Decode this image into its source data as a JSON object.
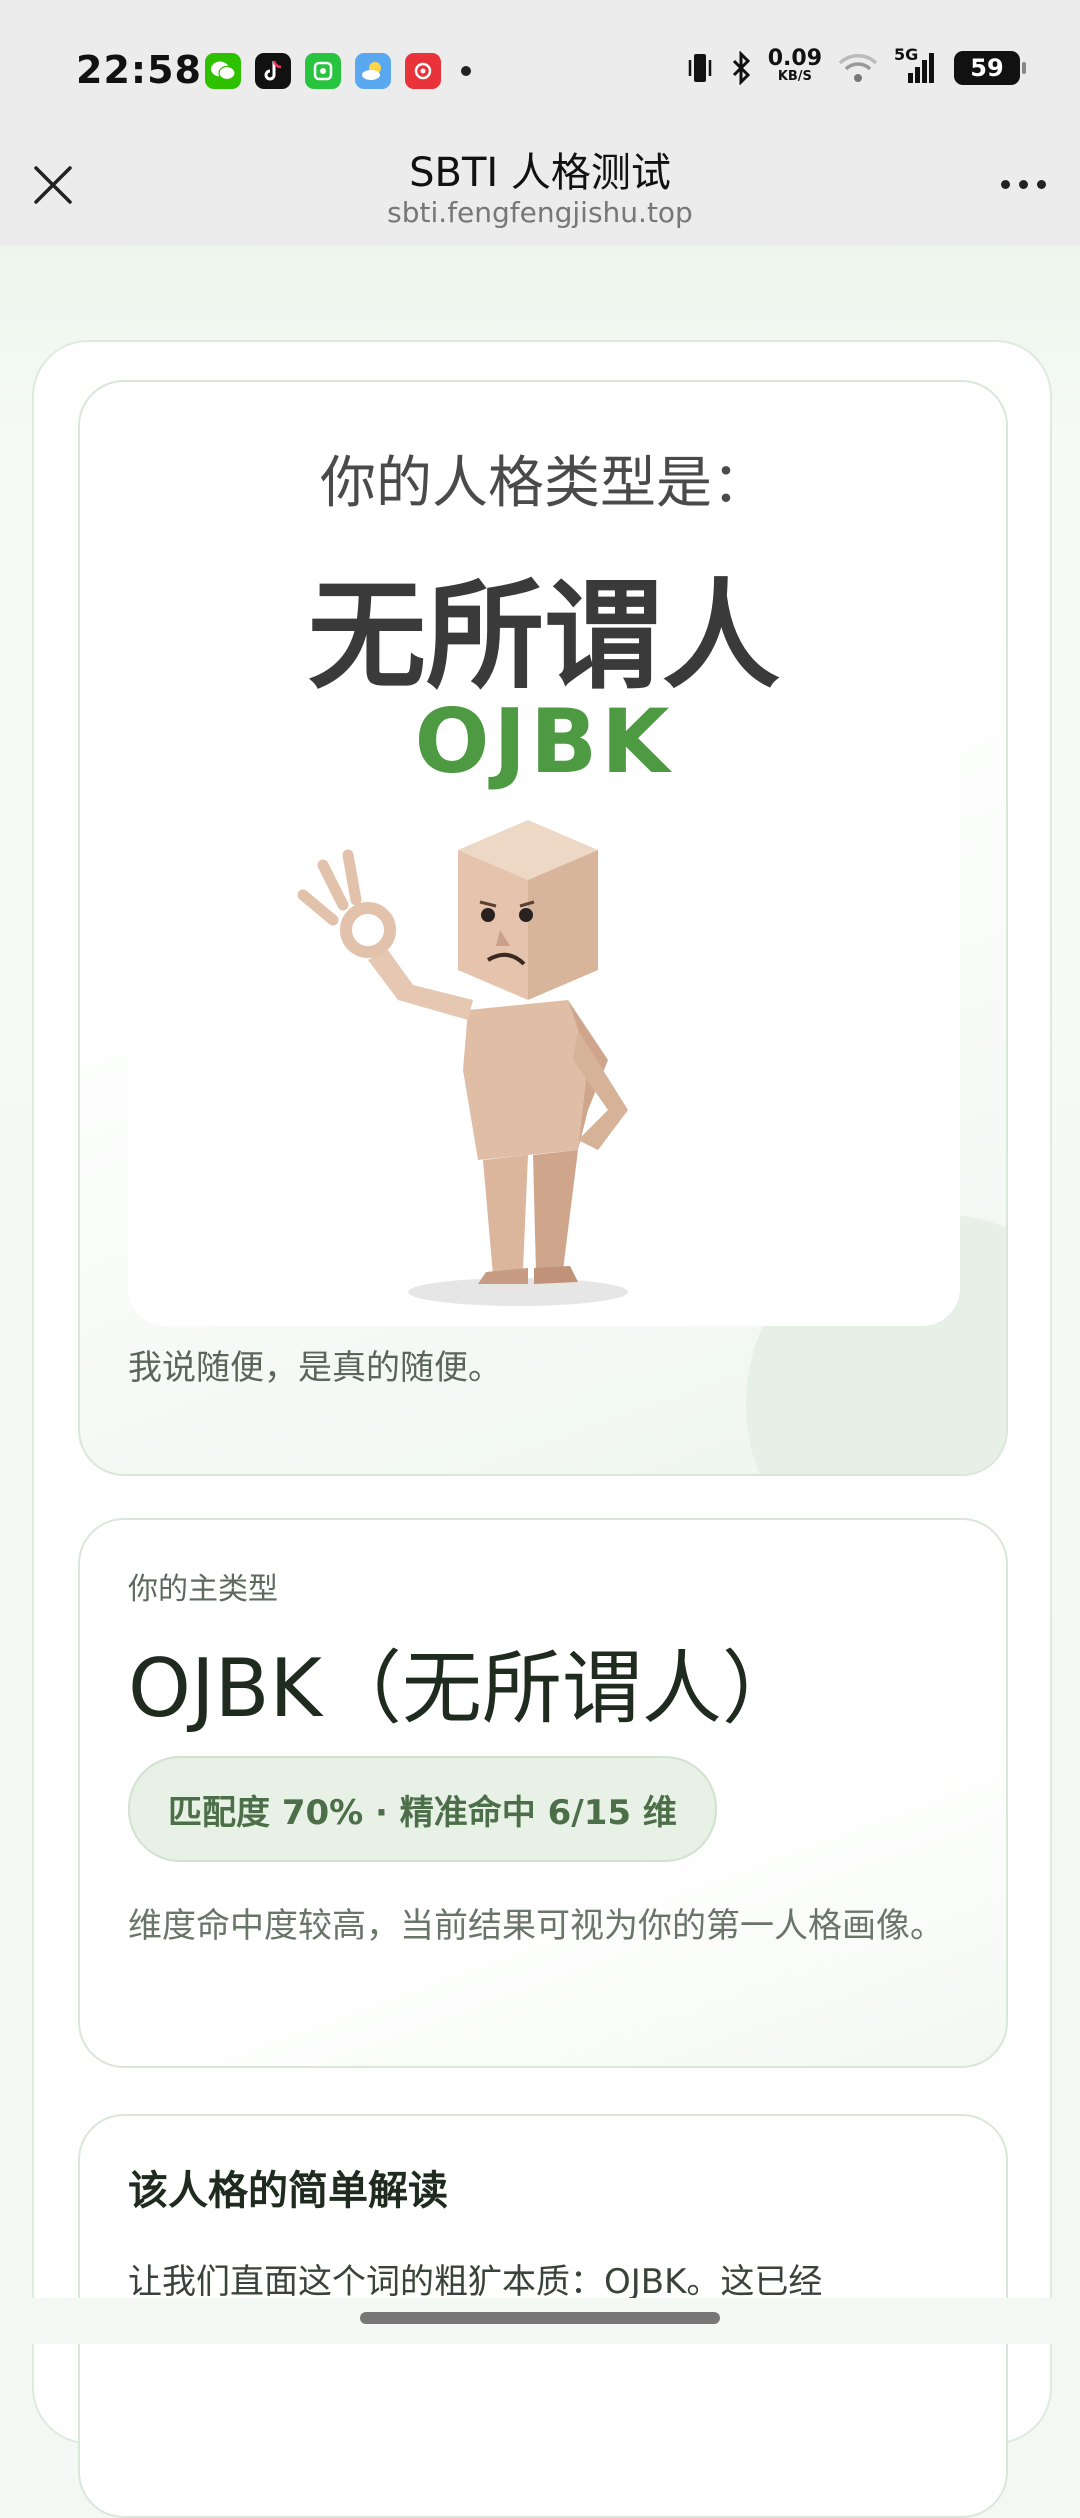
{
  "status_bar": {
    "time": "22:58",
    "app_icons": [
      {
        "name": "wechat-icon",
        "color": "#2dc100"
      },
      {
        "name": "tiktok-icon",
        "color": "#111111"
      },
      {
        "name": "wechat-pay-icon",
        "color": "#29c43f"
      },
      {
        "name": "weather-icon",
        "color": "#5aa9f0"
      },
      {
        "name": "netease-music-icon",
        "color": "#e8333a"
      }
    ],
    "net_speed": "0.09",
    "net_unit": "KB/S",
    "network": "5G",
    "battery": "59"
  },
  "nav": {
    "title": "SBTI 人格测试",
    "url": "sbti.fengfengjishu.top"
  },
  "hero": {
    "label": "你的人格类型是：",
    "name": "无所谓人",
    "code": "OJBK",
    "caption": "我说随便，是真的随便。"
  },
  "type_card": {
    "label": "你的主类型",
    "main": "OJBK（无所谓人）",
    "match": "匹配度 70% · 精准命中 6/15 维",
    "description": "维度命中度较高，当前结果可视为你的第一人格画像。"
  },
  "reading_card": {
    "title": "该人格的简单解读",
    "text": "让我们直面这个词的粗犷本质：OJBK。这已经"
  },
  "colors": {
    "accent_green": "#4d9a43",
    "pill_text": "#4c6e48"
  }
}
